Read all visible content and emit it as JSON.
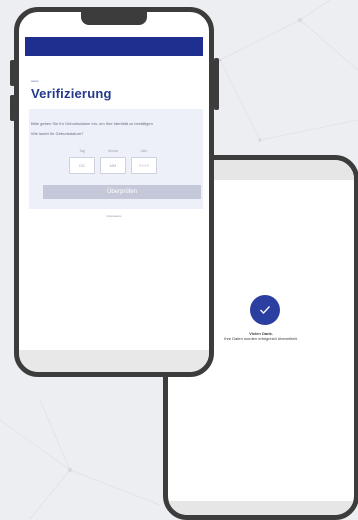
{
  "verification": {
    "brand": "swiss",
    "title": "Verifizierung",
    "intro": "Bitte geben Sie Ihr Geburtsdatum ein, um Ihre Identität zu bestätigen",
    "question": "Wie lautet Ihr Geburtsdatum?",
    "fields": [
      {
        "label": "Tag",
        "placeholder": "DD"
      },
      {
        "label": "Monat",
        "placeholder": "MM"
      },
      {
        "label": "Jahr",
        "placeholder": "YYYY"
      }
    ],
    "submit_label": "Überprüfen",
    "footer_link": "Impressum"
  },
  "confirmation": {
    "title": "Vielen Dank.",
    "message": "Ihre Daten wurden erfolgreich übermittelt."
  },
  "colors": {
    "brand_blue": "#1f2f8f",
    "title_blue": "#233a8c",
    "check_blue": "#2a3f9f",
    "panel": "#edf0f9",
    "button_disabled": "#c5c8d8",
    "phone_frame": "#3c3c3c"
  }
}
